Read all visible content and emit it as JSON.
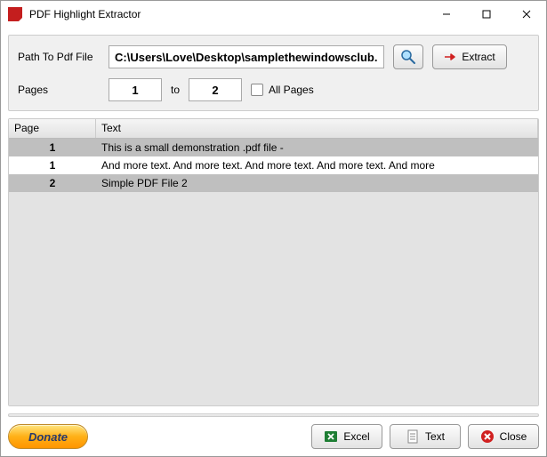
{
  "window": {
    "title": "PDF Highlight Extractor"
  },
  "form": {
    "path_label": "Path To Pdf File",
    "path_value": "C:\\Users\\Love\\Desktop\\samplethewindowsclub.pdf",
    "pages_label": "Pages",
    "page_from": "1",
    "page_to_label": "to",
    "page_to": "2",
    "all_pages_label": "All Pages",
    "extract_label": "Extract"
  },
  "grid": {
    "col_page": "Page",
    "col_text": "Text",
    "rows": [
      {
        "page": "1",
        "text": "This is a small demonstration .pdf file -"
      },
      {
        "page": "1",
        "text": "And more text. And more text. And more text. And more text. And more"
      },
      {
        "page": "2",
        "text": "Simple PDF File 2"
      }
    ]
  },
  "footer": {
    "donate": "Donate",
    "excel": "Excel",
    "text": "Text",
    "close": "Close"
  }
}
